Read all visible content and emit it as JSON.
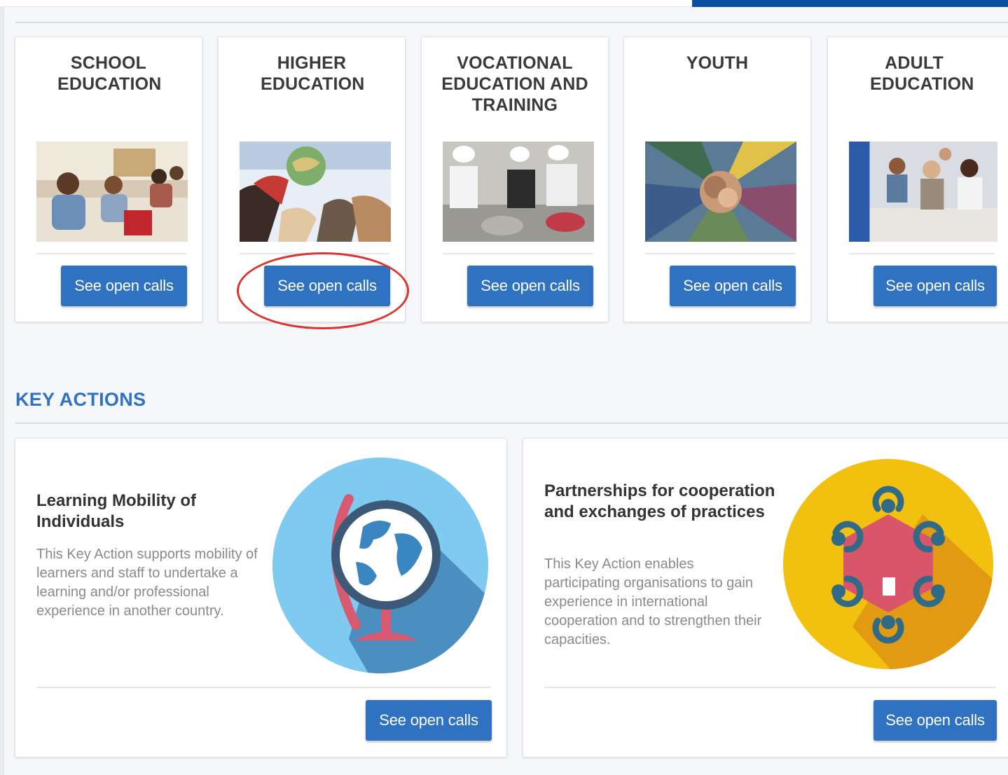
{
  "sectors": [
    {
      "title": "SCHOOL EDUCATION",
      "button": "See open calls"
    },
    {
      "title": "HIGHER EDUCATION",
      "button": "See open calls"
    },
    {
      "title": "VOCATIONAL EDUCATION AND TRAINING",
      "button": "See open calls"
    },
    {
      "title": "YOUTH",
      "button": "See open calls"
    },
    {
      "title": "ADULT EDUCATION",
      "button": "See open calls"
    }
  ],
  "key_actions": {
    "heading": "KEY ACTIONS",
    "items": [
      {
        "title": "Learning Mobility of Individuals",
        "description": "This Key Action supports mobility of learners and staff to undertake a learning and/or professional experience in another country.",
        "button": "See open calls"
      },
      {
        "title": "Partnerships for cooperation and exchanges of practices",
        "description": "This Key Action enables participating organisations to gain experience in international cooperation and to strengthen their capacities.",
        "button": "See open calls"
      }
    ]
  },
  "colors": {
    "accent": "#2f72c1",
    "brand_bar": "#0b4ea2",
    "highlight": "#d9362f"
  }
}
